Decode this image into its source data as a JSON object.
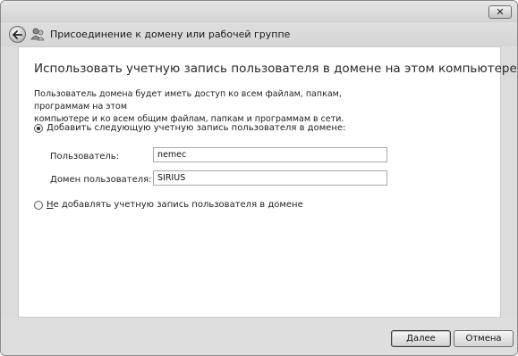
{
  "window": {
    "close_glyph": "✕",
    "nav_title": "Присоединение к домену или рабочей группе"
  },
  "main": {
    "heading": "Использовать учетную запись пользователя в домене на этом компьютере?",
    "description_line1": "Пользователь домена будет иметь доступ ко всем файлам, папкам, программам на этом",
    "description_line2": "компьютере и ко всем общим файлам, папкам и программам в сети.",
    "option_add": {
      "mnemonic": "Д",
      "label_rest": "обавить следующую учетную запись пользователя в домене:",
      "selected": true
    },
    "user_field": {
      "label": "Пользователь:",
      "value": "nemec"
    },
    "domain_field": {
      "label": "Домен пользователя:",
      "value": "SIRIUS"
    },
    "option_skip": {
      "mnemonic": "Н",
      "label_rest": "е добавлять учетную запись пользователя в домене",
      "selected": false
    }
  },
  "footer": {
    "next_mnemonic": "Д",
    "next_rest": "алее",
    "cancel_label": "Отмена"
  }
}
